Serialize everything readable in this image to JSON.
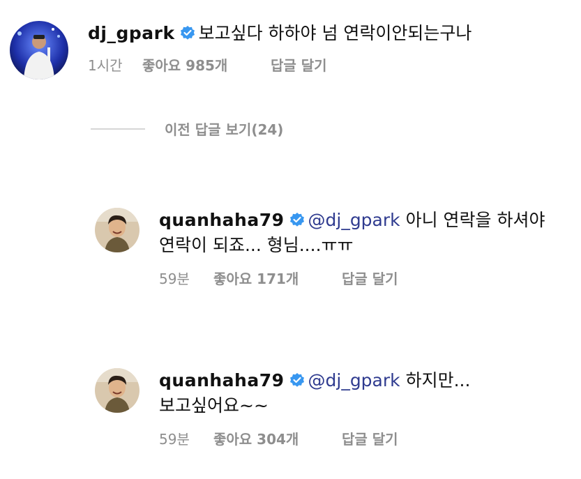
{
  "comments": [
    {
      "username": "dj_gpark",
      "mention": "",
      "text_line1": "보고싶다 하하야 넘 연락이안되는구나",
      "text_line2": "",
      "time": "1시간",
      "likes": "좋아요 985개",
      "reply": "답글 달기"
    },
    {
      "username": "quanhaha79",
      "mention": "@dj_gpark",
      "text_line1": "아니 연락을 하셔야",
      "text_line2": "연락이 되죠... 형님....ㅠㅠ",
      "time": "59분",
      "likes": "좋아요 171개",
      "reply": "답글 달기"
    },
    {
      "username": "quanhaha79",
      "mention": "@dj_gpark",
      "text_line1": "하지만...",
      "text_line2": "보고싶어요~~",
      "time": "59분",
      "likes": "좋아요 304개",
      "reply": "답글 달기"
    }
  ],
  "view_previous": "이전 답글 보기(24)",
  "colors": {
    "verified_badge": "#3897f0",
    "mention": "#2f3b8f",
    "meta_text": "#8e8e8e"
  },
  "icons": {
    "verified": "verified-badge-icon"
  }
}
